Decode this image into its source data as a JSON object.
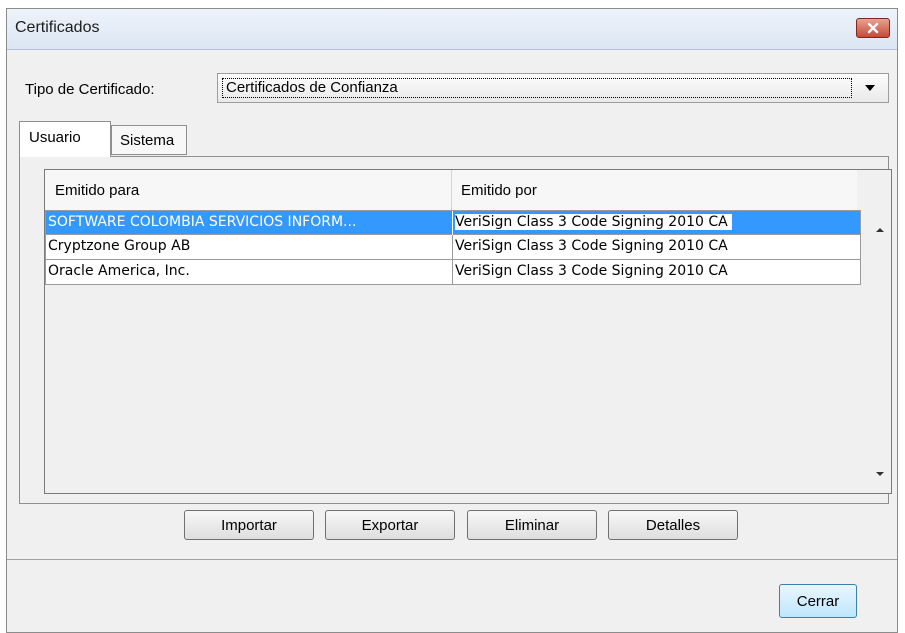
{
  "window": {
    "title": "Certificados"
  },
  "cert_type": {
    "label": "Tipo de Certificado:",
    "selected": "Certificados de Confianza"
  },
  "tabs": [
    {
      "label": "Usuario"
    },
    {
      "label": "Sistema"
    }
  ],
  "table": {
    "columns": [
      "Emitido para",
      "Emitido por"
    ],
    "rows": [
      {
        "issued_to": "SOFTWARE COLOMBIA SERVICIOS INFORM...",
        "issued_by": "VeriSign Class 3 Code Signing 2010 CA"
      },
      {
        "issued_to": "Cryptzone Group AB",
        "issued_by": "VeriSign Class 3 Code Signing 2010 CA"
      },
      {
        "issued_to": "Oracle America, Inc.",
        "issued_by": "VeriSign Class 3 Code Signing 2010 CA"
      }
    ]
  },
  "buttons": {
    "import": "Importar",
    "export": "Exportar",
    "delete": "Eliminar",
    "details": "Detalles",
    "close": "Cerrar"
  },
  "colors": {
    "selection": "#3399ff",
    "close_button": "#c74a36"
  }
}
